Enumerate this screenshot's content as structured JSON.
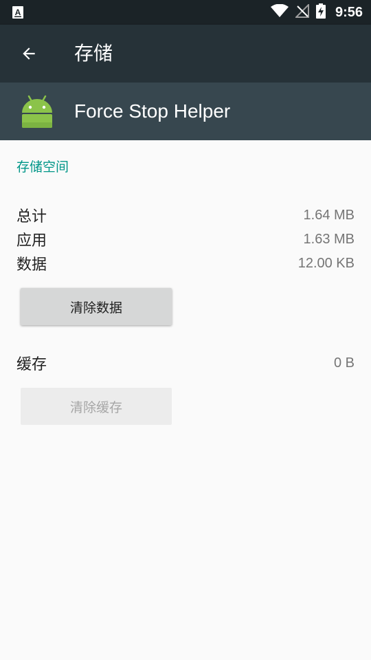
{
  "status_bar": {
    "time": "9:56",
    "icons": [
      "notification-a-icon",
      "wifi-icon",
      "no-signal-icon",
      "battery-charging-icon"
    ]
  },
  "toolbar": {
    "back_icon": "arrow-left-icon",
    "title": "存储"
  },
  "app_header": {
    "icon": "android-icon",
    "name": "Force Stop Helper"
  },
  "storage": {
    "section_title": "存储空间",
    "rows": [
      {
        "label": "总计",
        "value": "1.64 MB"
      },
      {
        "label": "应用",
        "value": "1.63 MB"
      },
      {
        "label": "数据",
        "value": "12.00 KB"
      }
    ],
    "clear_data_label": "清除数据",
    "cache_label": "缓存",
    "cache_value": "0 B",
    "clear_cache_label": "清除缓存"
  },
  "colors": {
    "status_bar": "#1b2327",
    "toolbar": "#263238",
    "app_header": "#37474f",
    "accent": "#009688",
    "background": "#fafafa"
  }
}
